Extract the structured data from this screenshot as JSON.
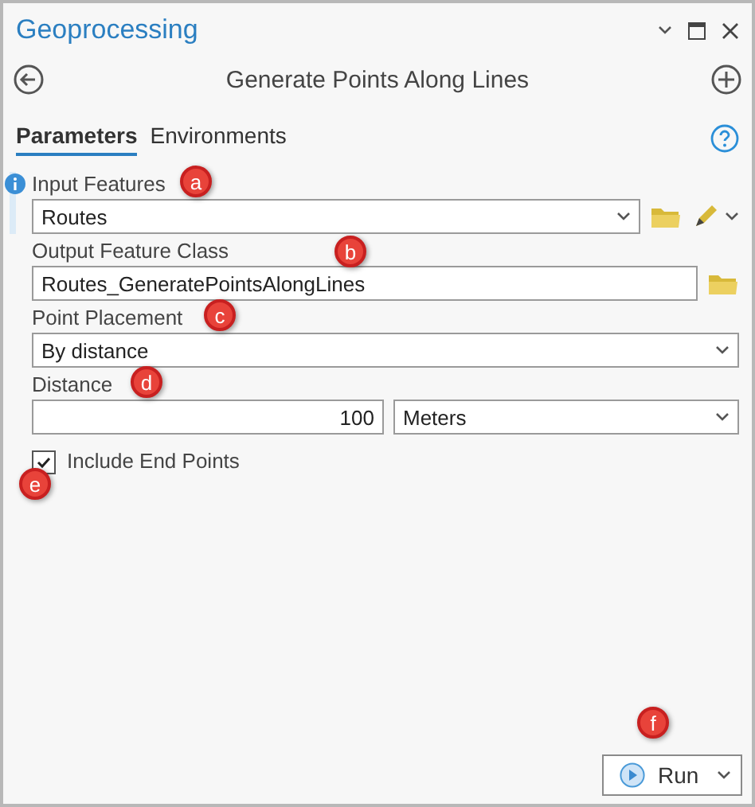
{
  "pane": {
    "title": "Geoprocessing"
  },
  "tool": {
    "title": "Generate Points Along Lines"
  },
  "tabs": [
    {
      "label": "Parameters",
      "selected": true
    },
    {
      "label": "Environments",
      "selected": false
    }
  ],
  "parameters": [
    {
      "kind": "select",
      "label": "Input Features",
      "value": "Routes",
      "info": true,
      "browse": true,
      "edit": true,
      "callout": "a"
    },
    {
      "kind": "text",
      "label": "Output Feature Class",
      "value": "Routes_GeneratePointsAlongLines",
      "info": false,
      "browse": true,
      "edit": false,
      "callout": "b"
    },
    {
      "kind": "select",
      "label": "Point Placement",
      "value": "By distance",
      "info": false,
      "browse": false,
      "edit": false,
      "callout": "c"
    },
    {
      "kind": "linear",
      "label": "Distance",
      "value": "100",
      "unit": "Meters",
      "info": false,
      "browse": false,
      "edit": false,
      "callout": "d"
    },
    {
      "kind": "checkbox",
      "label": "Include End Points",
      "checked": true,
      "callout": "e"
    }
  ],
  "run": {
    "label": "Run",
    "callout": "f"
  }
}
